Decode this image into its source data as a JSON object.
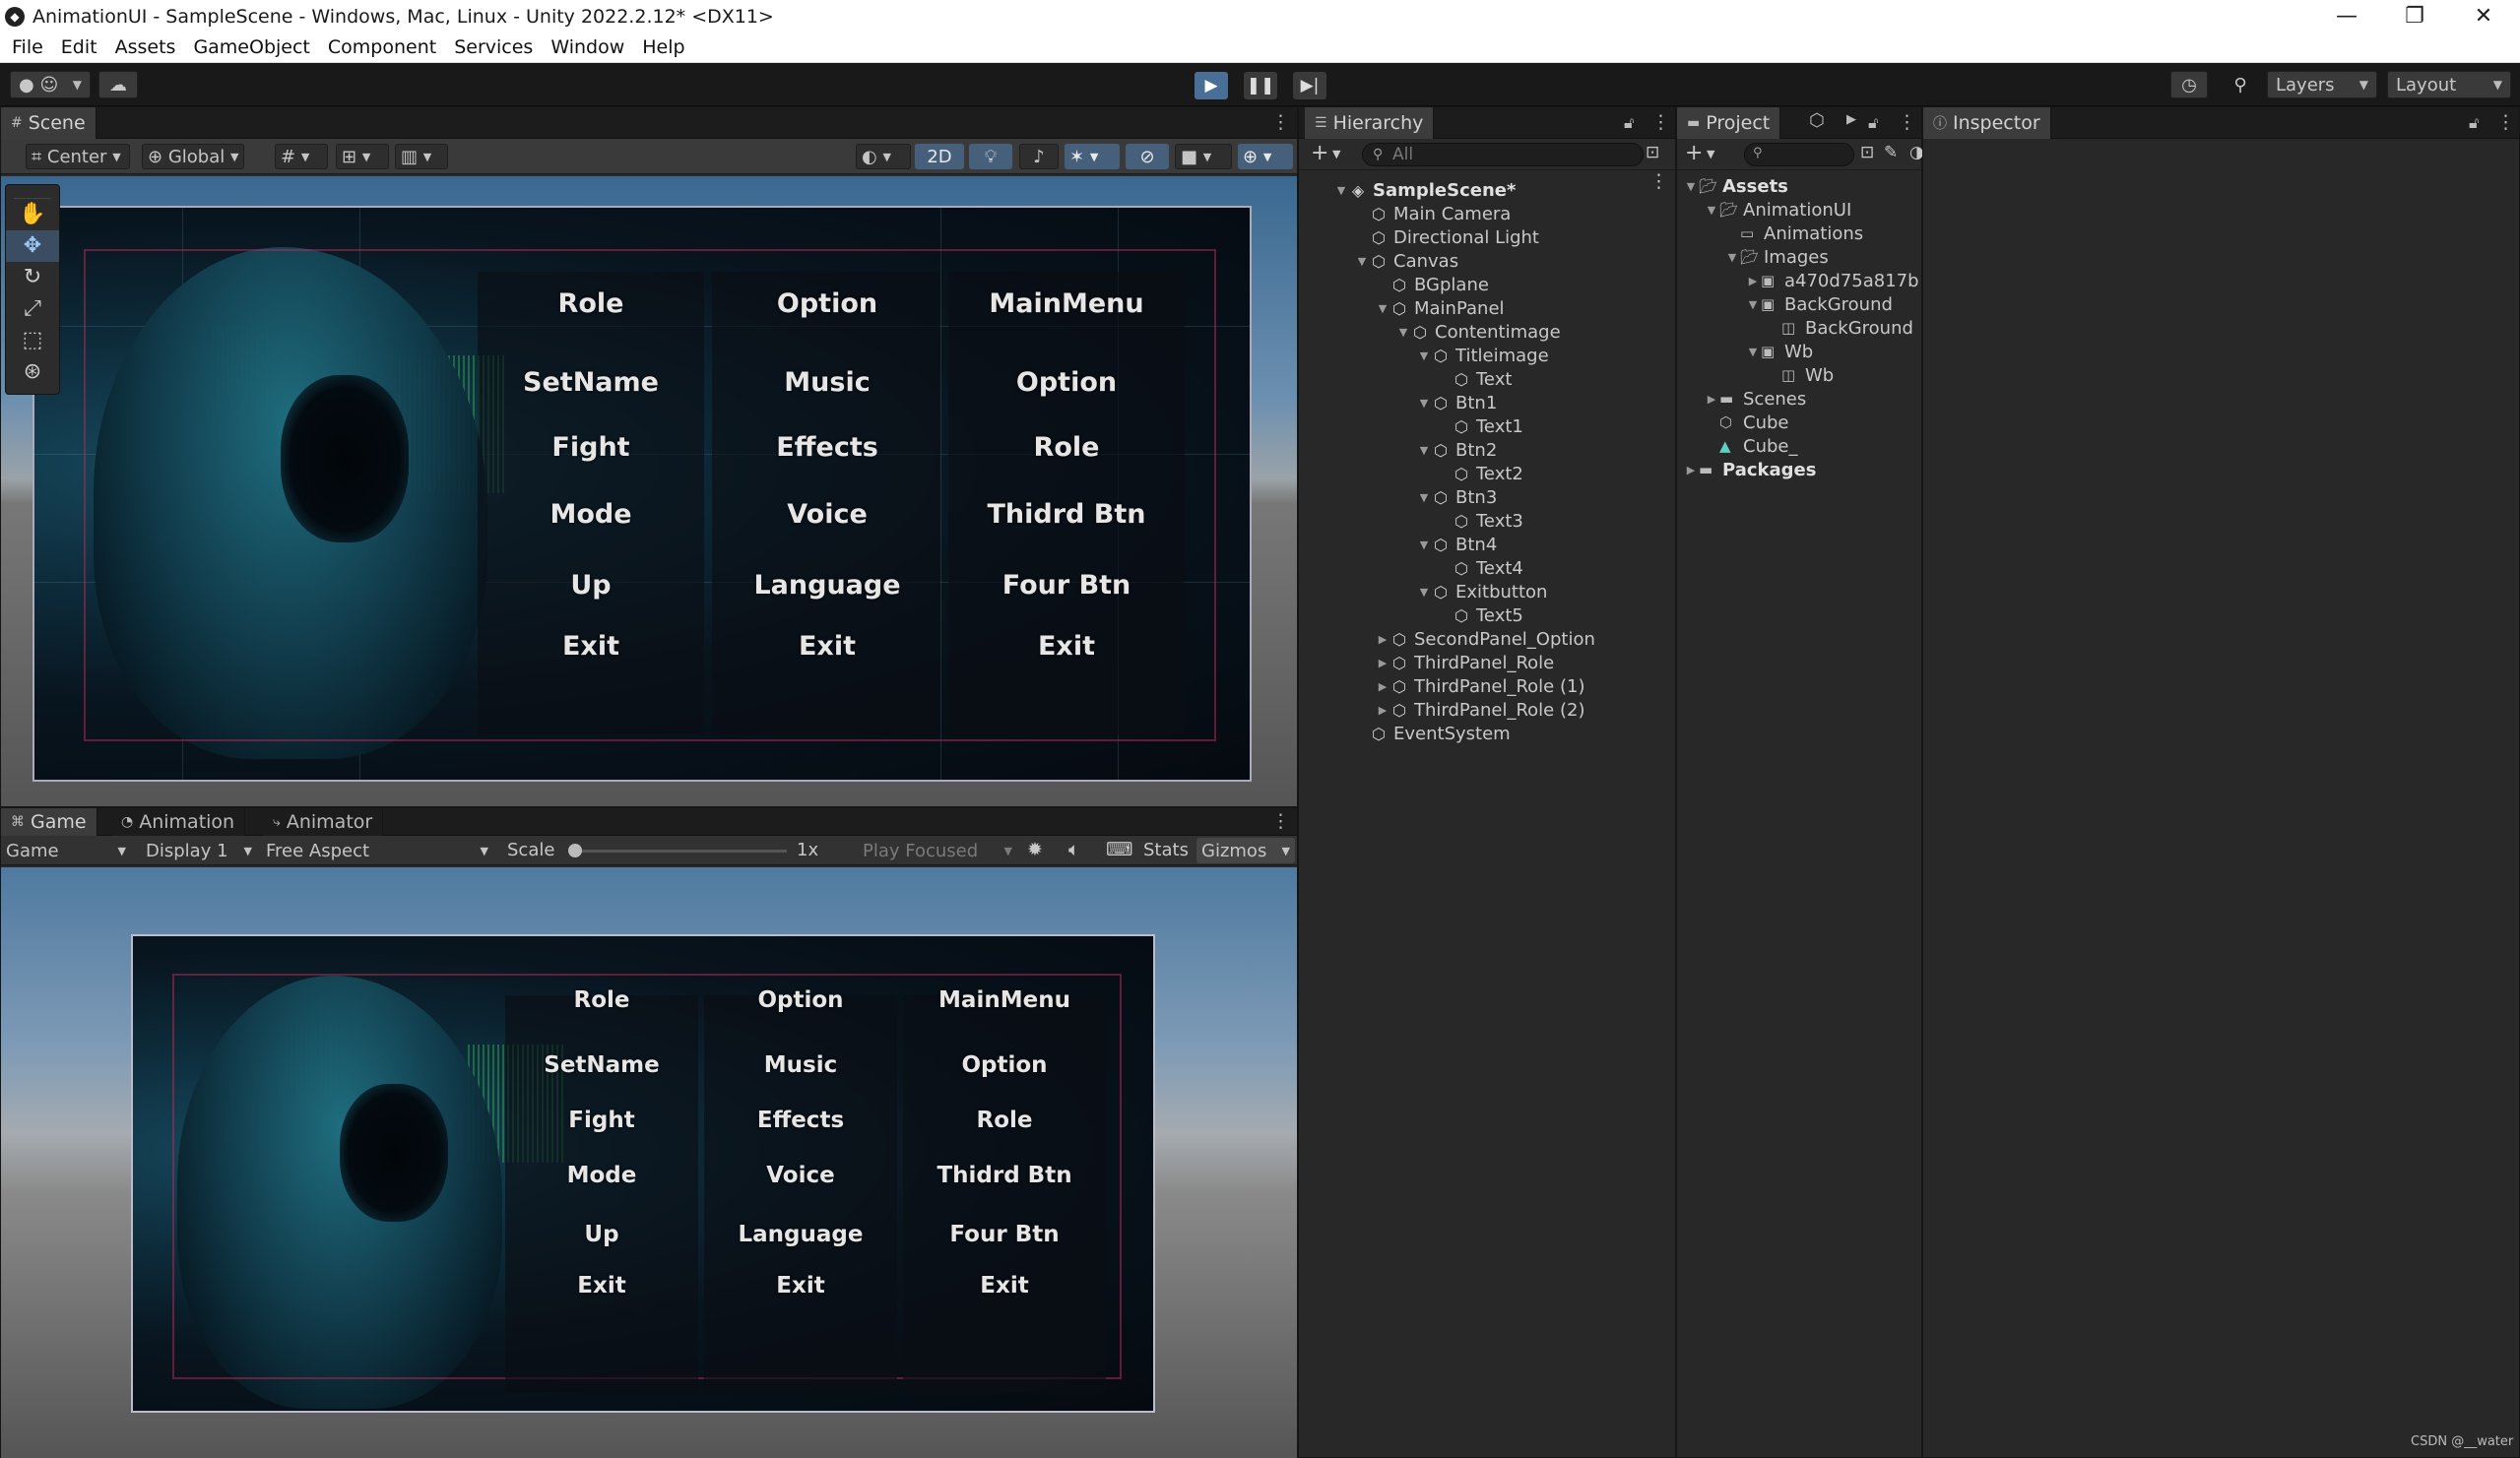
{
  "window": {
    "title": "AnimationUI - SampleScene - Windows, Mac, Linux - Unity 2022.2.12* <DX11>",
    "minimize": "—",
    "maximize": "❐",
    "close": "✕"
  },
  "menu": [
    "File",
    "Edit",
    "Assets",
    "GameObject",
    "Component",
    "Services",
    "Window",
    "Help"
  ],
  "toolbar": {
    "account_label": "☺",
    "layers": "Layers",
    "layout": "Layout"
  },
  "scene": {
    "tab": "Scene",
    "pivot": "Center",
    "space": "Global",
    "mode_2d": "2D"
  },
  "game": {
    "tabs": [
      "Game",
      "Animation",
      "Animator"
    ],
    "view_select": "Game",
    "display": "Display 1",
    "aspect": "Free Aspect",
    "scale_label": "Scale",
    "scale_value": "1x",
    "play_focused": "Play Focused",
    "stats": "Stats",
    "gizmos": "Gizmos"
  },
  "ui_grid": {
    "columns": [
      [
        "Role",
        "SetName",
        "Fight",
        "Mode",
        "Up",
        "Exit"
      ],
      [
        "Option",
        "Music",
        "Effects",
        "Voice",
        "Language",
        "Exit"
      ],
      [
        "MainMenu",
        "Option",
        "Role",
        "Thidrd Btn",
        "Four Btn",
        "Exit"
      ]
    ]
  },
  "hierarchy": {
    "tab": "Hierarchy",
    "search_placeholder": "All",
    "items": [
      {
        "label": "SampleScene*",
        "depth": 0,
        "arrow": "▼",
        "icon": "unity"
      },
      {
        "label": "Main Camera",
        "depth": 1,
        "arrow": "",
        "icon": "cube"
      },
      {
        "label": "Directional Light",
        "depth": 1,
        "arrow": "",
        "icon": "cube"
      },
      {
        "label": "Canvas",
        "depth": 1,
        "arrow": "▼",
        "icon": "cube"
      },
      {
        "label": "BGplane",
        "depth": 2,
        "arrow": "",
        "icon": "cube"
      },
      {
        "label": "MainPanel",
        "depth": 2,
        "arrow": "▼",
        "icon": "cube"
      },
      {
        "label": "Contentimage",
        "depth": 3,
        "arrow": "▼",
        "icon": "cube"
      },
      {
        "label": "Titleimage",
        "depth": 4,
        "arrow": "▼",
        "icon": "cube"
      },
      {
        "label": "Text",
        "depth": 5,
        "arrow": "",
        "icon": "cube"
      },
      {
        "label": "Btn1",
        "depth": 4,
        "arrow": "▼",
        "icon": "cube"
      },
      {
        "label": "Text1",
        "depth": 5,
        "arrow": "",
        "icon": "cube"
      },
      {
        "label": "Btn2",
        "depth": 4,
        "arrow": "▼",
        "icon": "cube"
      },
      {
        "label": "Text2",
        "depth": 5,
        "arrow": "",
        "icon": "cube"
      },
      {
        "label": "Btn3",
        "depth": 4,
        "arrow": "▼",
        "icon": "cube"
      },
      {
        "label": "Text3",
        "depth": 5,
        "arrow": "",
        "icon": "cube"
      },
      {
        "label": "Btn4",
        "depth": 4,
        "arrow": "▼",
        "icon": "cube"
      },
      {
        "label": "Text4",
        "depth": 5,
        "arrow": "",
        "icon": "cube"
      },
      {
        "label": "Exitbutton",
        "depth": 4,
        "arrow": "▼",
        "icon": "cube"
      },
      {
        "label": "Text5",
        "depth": 5,
        "arrow": "",
        "icon": "cube"
      },
      {
        "label": "SecondPanel_Option",
        "depth": 2,
        "arrow": "▶",
        "icon": "cube"
      },
      {
        "label": "ThirdPanel_Role",
        "depth": 2,
        "arrow": "▶",
        "icon": "cube"
      },
      {
        "label": "ThirdPanel_Role (1)",
        "depth": 2,
        "arrow": "▶",
        "icon": "cube"
      },
      {
        "label": "ThirdPanel_Role (2)",
        "depth": 2,
        "arrow": "▶",
        "icon": "cube"
      },
      {
        "label": "EventSystem",
        "depth": 1,
        "arrow": "",
        "icon": "cube"
      }
    ]
  },
  "project": {
    "tab": "Project",
    "items": [
      {
        "label": "Assets",
        "depth": 0,
        "arrow": "▼",
        "icon": "folder-open",
        "bold": true
      },
      {
        "label": "AnimationUI",
        "depth": 1,
        "arrow": "▼",
        "icon": "folder-open"
      },
      {
        "label": "Animations",
        "depth": 2,
        "arrow": "",
        "icon": "folder-empty"
      },
      {
        "label": "Images",
        "depth": 2,
        "arrow": "▼",
        "icon": "folder-open"
      },
      {
        "label": "a470d75a817b",
        "depth": 3,
        "arrow": "▶",
        "icon": "image"
      },
      {
        "label": "BackGround",
        "depth": 3,
        "arrow": "▼",
        "icon": "image"
      },
      {
        "label": "BackGround",
        "depth": 4,
        "arrow": "",
        "icon": "sprite"
      },
      {
        "label": "Wb",
        "depth": 3,
        "arrow": "▼",
        "icon": "image"
      },
      {
        "label": "Wb",
        "depth": 4,
        "arrow": "",
        "icon": "sprite"
      },
      {
        "label": "Scenes",
        "depth": 1,
        "arrow": "▶",
        "icon": "folder"
      },
      {
        "label": "Cube",
        "depth": 1,
        "arrow": "",
        "icon": "prefab"
      },
      {
        "label": "Cube_",
        "depth": 1,
        "arrow": "",
        "icon": "mesh"
      },
      {
        "label": "Packages",
        "depth": 0,
        "arrow": "▶",
        "icon": "folder",
        "bold": true
      }
    ]
  },
  "inspector": {
    "tab": "Inspector"
  },
  "watermark": "CSDN @__water"
}
